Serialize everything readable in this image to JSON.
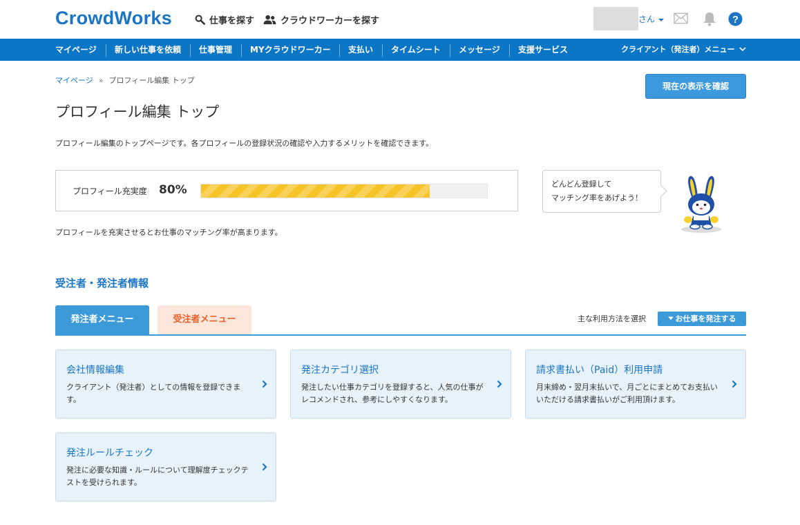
{
  "header": {
    "logo": "CrowdWorks",
    "find_jobs": "仕事を探す",
    "find_workers": "クラウドワーカーを探す",
    "user_suffix": "さん"
  },
  "nav": {
    "items": [
      "マイページ",
      "新しい仕事を依頼",
      "仕事管理",
      "MYクラウドワーカー",
      "支払い",
      "タイムシート",
      "メッセージ",
      "支援サービス"
    ],
    "client_menu": "クライアント（発注者）メニュー"
  },
  "breadcrumb": {
    "home": "マイページ",
    "separator": "»",
    "current": "プロフィール編集 トップ"
  },
  "confirm_button": "現在の表示を確認",
  "page": {
    "title": "プロフィール編集 トップ",
    "description": "プロフィール編集のトップページです。各プロフィールの登録状況の確認や入力するメリットを確認できます。"
  },
  "profile": {
    "label": "プロフィール充実度",
    "percent_text": "80%",
    "progress_fraction": 0.8,
    "note": "プロフィールを充実させるとお仕事のマッチング率が高まります。"
  },
  "bubble": {
    "line1": "どんどん登録して",
    "line2": "マッチング率をあげよう！"
  },
  "section": {
    "title": "受注者・発注者情報",
    "tab_client": "発注者メニュー",
    "tab_worker": "受注者メニュー",
    "usage_label": "主な利用方法を選択",
    "usage_button": "お仕事を発注する"
  },
  "cards": [
    {
      "title": "会社情報編集",
      "desc": "クライアント（発注者）としての情報を登録できます。"
    },
    {
      "title": "発注カテゴリ選択",
      "desc": "発注したい仕事カテゴリを登録すると、人気の仕事がレコメンドされ、参考にしやすくなります。"
    },
    {
      "title": "請求書払い（Paid）利用申請",
      "desc": "月末締め・翌月末払いで、月ごとにまとめてお支払いいただける請求書払いがご利用頂けます。"
    },
    {
      "title": "発注ルールチェック",
      "desc": "発注に必要な知識・ルールについて理解度チェックテストを受けられます。"
    }
  ],
  "colors": {
    "brand": "#1a75c4",
    "nav": "#0b75c6",
    "progress": "#f6c426",
    "worker_tab": "#e8622c"
  },
  "icons": [
    "search-icon",
    "users-icon",
    "mail-icon",
    "bell-icon",
    "help-icon",
    "chevron-down-icon",
    "chevron-right-icon"
  ]
}
